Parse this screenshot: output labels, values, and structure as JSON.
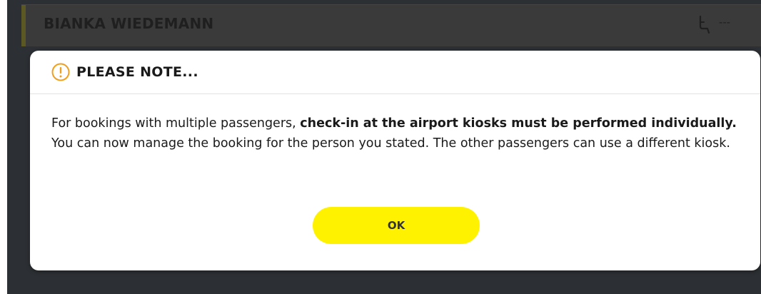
{
  "passenger": {
    "name": "BIANKA WIEDEMANN",
    "seat_icon": "seat-icon",
    "seat_value": "---"
  },
  "dialog": {
    "icon": "warning-circle-icon",
    "title": "PLEASE NOTE...",
    "body": {
      "part1": "For bookings with multiple passengers, ",
      "bold": "check-in at the airport kiosks must be performed individually.",
      "part2": " You can now manage the booking for the person you stated. The other passengers can use a different kiosk."
    },
    "ok_label": "OK"
  },
  "colors": {
    "accent_yellow": "#fff200",
    "warning_orange": "#f0a020",
    "background_dark": "#2c2f33"
  }
}
